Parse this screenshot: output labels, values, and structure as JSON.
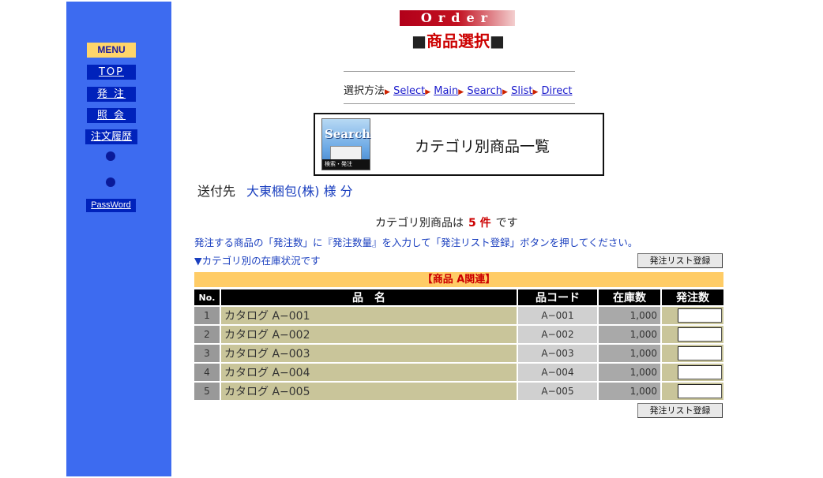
{
  "sidebar": {
    "menu_label": "MENU",
    "top_label": "TOP",
    "order_label": "発 注",
    "inquiry_label": "照 会",
    "history_label": "注文履歴",
    "password_label": "PassWord"
  },
  "header": {
    "order_banner": "Order",
    "title": "商品選択"
  },
  "method": {
    "label": "選択方法",
    "links": [
      "Select",
      "Main",
      "Search",
      "Slist",
      "Direct"
    ]
  },
  "category_box": {
    "icon_text": "Search",
    "icon_caption": "検索・発注",
    "title": "カテゴリ別商品一覧"
  },
  "destination": {
    "label": "送付先",
    "name": "大東梱包(株) 様 分"
  },
  "count": {
    "prefix": "カテゴリ別商品は",
    "value": "5 件",
    "suffix": "です"
  },
  "instruction": "発注する商品の「発注数」に『発注数量』を入力して「発注リスト登録」ボタンを押してください。",
  "stock_link": "▼カテゴリ別の在庫状況です",
  "register_button": "発注リスト登録",
  "category_band": "【商品 A関連】",
  "table": {
    "headers": [
      "No.",
      "品　名",
      "品コード",
      "在庫数",
      "発注数"
    ],
    "rows": [
      {
        "no": "1",
        "name": "カタログ A−001",
        "code": "A−001",
        "stock": "1,000",
        "qty": ""
      },
      {
        "no": "2",
        "name": "カタログ A−002",
        "code": "A−002",
        "stock": "1,000",
        "qty": ""
      },
      {
        "no": "3",
        "name": "カタログ A−003",
        "code": "A−003",
        "stock": "1,000",
        "qty": ""
      },
      {
        "no": "4",
        "name": "カタログ A−004",
        "code": "A−004",
        "stock": "1,000",
        "qty": ""
      },
      {
        "no": "5",
        "name": "カタログ A−005",
        "code": "A−005",
        "stock": "1,000",
        "qty": ""
      }
    ]
  },
  "colors": {
    "sidebar": "#3d6bf0",
    "nav_button": "#0022bb",
    "menu_head": "#ffd56a",
    "band": "#ffcc66",
    "accent_red": "#cc0000",
    "link_blue": "#1a3fbf"
  }
}
